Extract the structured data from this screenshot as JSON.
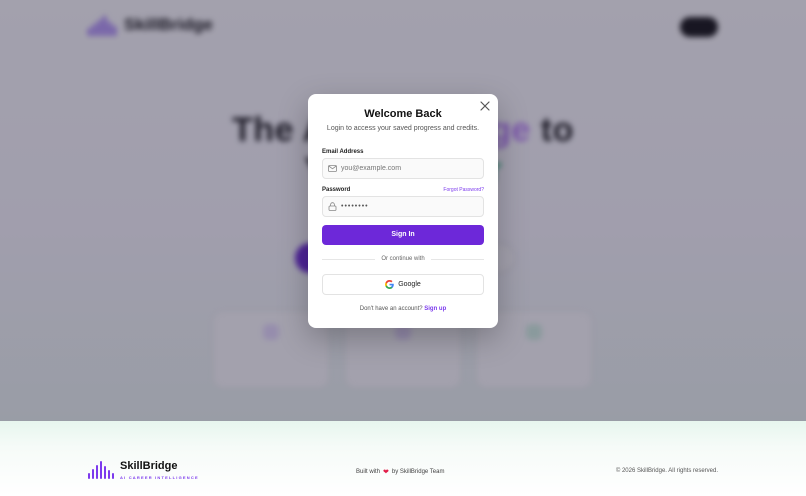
{
  "brand": {
    "name": "SkillBridge",
    "tagline": "AI CAREER INTELLIGENCE"
  },
  "colors": {
    "accent": "#6d28d9",
    "accent_light": "#7c3aed",
    "green": "#34c283",
    "heart": "#e11d48"
  },
  "modal": {
    "title": "Welcome Back",
    "subtitle": "Login to access your saved progress and credits.",
    "email_label": "Email Address",
    "email_placeholder": "you@example.com",
    "password_label": "Password",
    "forgot_label": "Forgot Password?",
    "password_value": "••••••••",
    "signin_label": "Sign In",
    "divider_text": "Or continue with",
    "google_label": "Google",
    "signup_prompt": "Don't have an account?",
    "signup_link": "Sign up",
    "icons": {
      "close": "close-icon",
      "mail": "mail-icon",
      "lock": "lock-icon",
      "google": "google-icon"
    }
  },
  "footer": {
    "built_prefix": "Built with",
    "built_suffix": "by SkillBridge Team",
    "copyright": "© 2026 SkillBridge. All rights reserved."
  }
}
